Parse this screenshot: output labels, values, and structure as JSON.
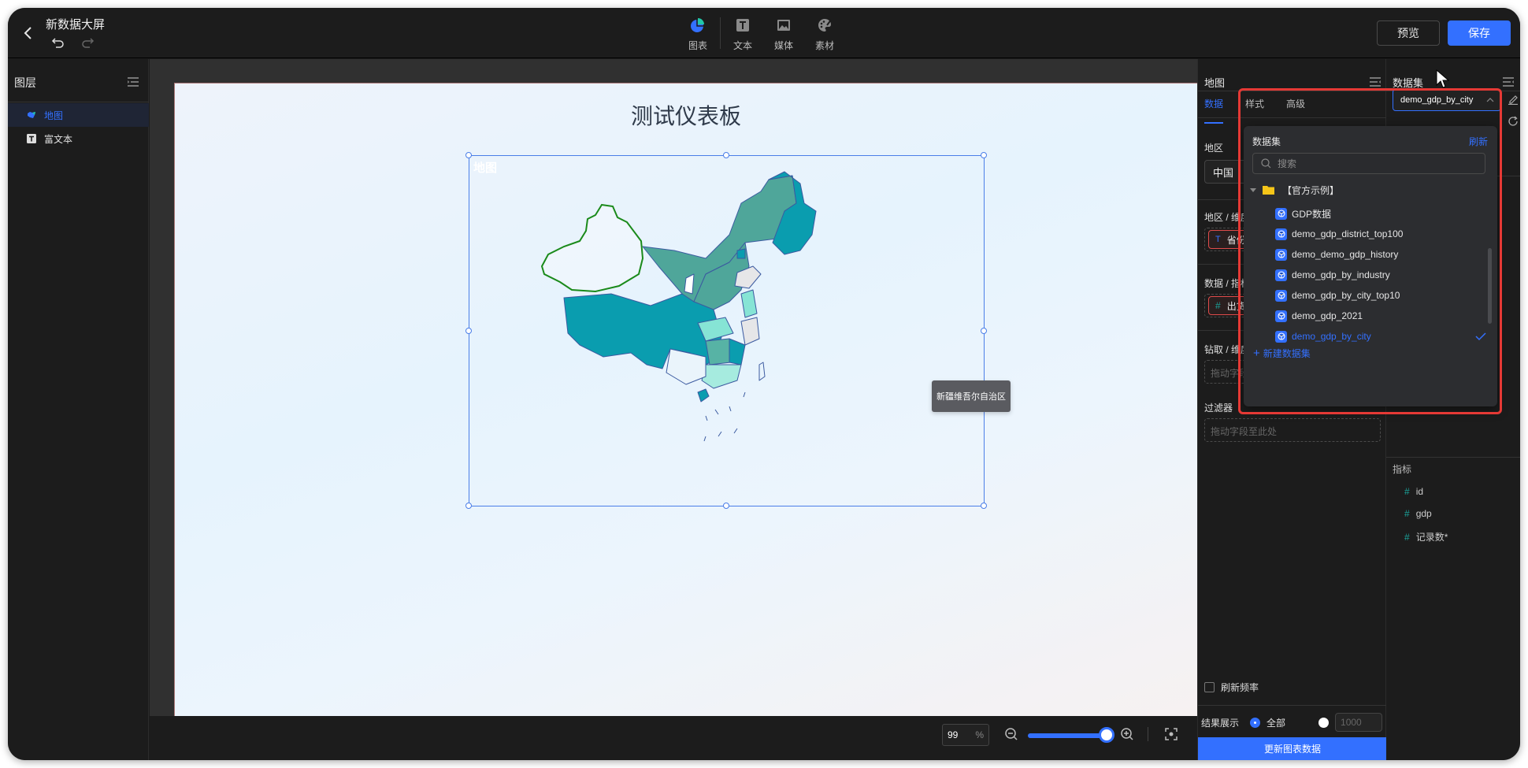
{
  "header": {
    "title": "新数据大屏",
    "toolbar": [
      {
        "id": "chart",
        "label": "图表",
        "icon": "pie-chart-icon"
      },
      {
        "id": "text",
        "label": "文本",
        "icon": "text-icon"
      },
      {
        "id": "media",
        "label": "媒体",
        "icon": "image-icon"
      },
      {
        "id": "material",
        "label": "素材",
        "icon": "palette-icon"
      }
    ],
    "preview_label": "预览",
    "save_label": "保存"
  },
  "layers": {
    "title": "图层",
    "items": [
      {
        "label": "地图",
        "icon": "map-icon",
        "active": true
      },
      {
        "label": "富文本",
        "icon": "text-icon",
        "active": false
      }
    ]
  },
  "canvas": {
    "title": "测试仪表板",
    "component_label": "地图",
    "tooltip": "新疆维吾尔自治区",
    "zoom_value": "99",
    "zoom_unit": "%",
    "zoom_level": 0.99
  },
  "config": {
    "title": "地图",
    "tabs": [
      {
        "label": "数据",
        "active": true
      },
      {
        "label": "样式",
        "active": false
      },
      {
        "label": "高级",
        "active": false
      }
    ],
    "region_label": "地区",
    "region_value": "中国",
    "dimension_label": "地区 / 维度",
    "dimension_field": "省份",
    "metric_label": "数据 / 指标",
    "metric_field": "出货量",
    "drill_label": "钻取 / 维度",
    "drill_placeholder": "拖动字段至此处",
    "filter_label": "过滤器",
    "filter_placeholder": "拖动字段至此处",
    "refresh_rate_label": "刷新频率",
    "result_label": "结果展示",
    "result_all_label": "全部",
    "result_limit_placeholder": "1000",
    "update_button": "更新图表数据"
  },
  "dataset": {
    "title": "数据集",
    "selected": "demo_gdp_by_city",
    "metrics_title": "指标",
    "metrics": [
      "id",
      "gdp",
      "记录数*"
    ]
  },
  "dropdown": {
    "title": "数据集",
    "refresh_label": "刷新",
    "search_placeholder": "搜索",
    "folder": "【官方示例】",
    "items": [
      {
        "label": "GDP数据",
        "selected": false
      },
      {
        "label": "demo_gdp_district_top100",
        "selected": false
      },
      {
        "label": "demo_demo_gdp_history",
        "selected": false
      },
      {
        "label": "demo_gdp_by_industry",
        "selected": false
      },
      {
        "label": "demo_gdp_by_city_top10",
        "selected": false
      },
      {
        "label": "demo_gdp_2021",
        "selected": false
      },
      {
        "label": "demo_gdp_by_city",
        "selected": true
      }
    ],
    "new_label": "新建数据集"
  },
  "colors": {
    "accent": "#3370ff",
    "highlight": "#e53935",
    "map_dark": "#0a9daf",
    "map_mid": "#4fa69a",
    "map_light": "#86e4d5",
    "map_hover_border": "#1a8a1a"
  }
}
